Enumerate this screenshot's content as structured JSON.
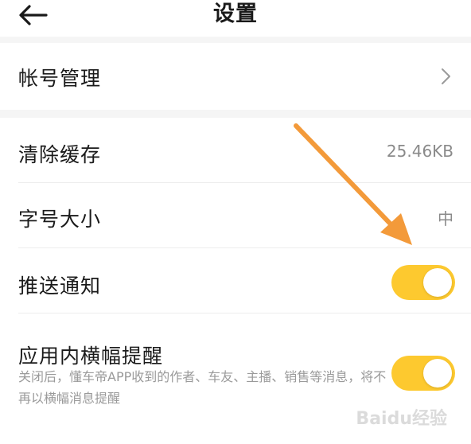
{
  "header": {
    "title": "设置",
    "back_icon": "arrow-left-icon"
  },
  "account": {
    "label": "帐号管理",
    "chevron_icon": "chevron-right-icon"
  },
  "cache": {
    "label": "清除缓存",
    "value": "25.46KB"
  },
  "font_size": {
    "label": "字号大小",
    "value": "中"
  },
  "push": {
    "label": "推送通知",
    "enabled": true
  },
  "banner": {
    "label": "应用内横幅提醒",
    "description": "关闭后，懂车帝APP收到的作者、车友、主播、销售等消息，将不再以横幅消息提醒",
    "enabled": true
  },
  "colors": {
    "toggle_on": "#fdc92f",
    "arrow": "#f39a3a",
    "section_gap": "#f5f5f5"
  },
  "watermark": {
    "text": "Baidu经验"
  }
}
